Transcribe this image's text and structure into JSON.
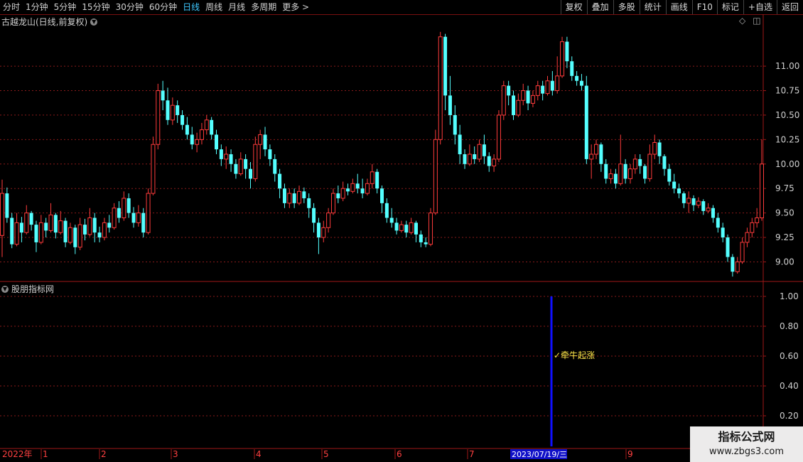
{
  "toolbar": {
    "periods": [
      "分时",
      "1分钟",
      "5分钟",
      "15分钟",
      "30分钟",
      "60分钟",
      "日线",
      "周线",
      "月线",
      "多周期",
      "更多 >"
    ],
    "active_index": 6,
    "right_buttons": [
      "复权",
      "叠加",
      "多股",
      "统计",
      "画线",
      "F10",
      "标记",
      "+自选",
      "返回"
    ]
  },
  "main_panel": {
    "title": "古越龙山(日线,前复权)",
    "price_labels": [
      "11.00",
      "10.75",
      "10.50",
      "10.25",
      "10.00",
      "9.75",
      "9.50",
      "9.25",
      "9.00"
    ]
  },
  "indicator_panel": {
    "title": "股朋指标网",
    "signal_label": "牵牛起涨",
    "axis_labels": [
      "1.00",
      "0.80",
      "0.60",
      "0.40",
      "0.20"
    ]
  },
  "time_axis": {
    "year_label": "2022年",
    "months": [
      "1",
      "2",
      "3",
      "4",
      "5",
      "6",
      "7",
      "9"
    ],
    "cursor_date": "2023/07/19/三"
  },
  "watermark": {
    "title": "指标公式网",
    "url": "www.zbgs3.com"
  },
  "colors": {
    "up": "#ff3b3b",
    "down": "#54ffff",
    "grid": "#8a1a1a",
    "signal": "#1010ff",
    "label": "#ffe84a"
  },
  "chart_data": {
    "type": "candlestick",
    "ylim": [
      8.8,
      11.4
    ],
    "indicator_ylim": [
      0,
      1.05
    ],
    "indicator_signal_value": 1.0,
    "candles": [
      [
        9.27,
        9.7,
        9.05,
        9.84
      ],
      [
        9.7,
        9.45,
        9.4,
        9.76
      ],
      [
        9.45,
        9.18,
        9.14,
        9.5
      ],
      [
        9.18,
        9.4,
        9.16,
        9.5
      ],
      [
        9.4,
        9.3,
        9.2,
        9.46
      ],
      [
        9.3,
        9.5,
        9.28,
        9.58
      ],
      [
        9.5,
        9.38,
        9.32,
        9.52
      ],
      [
        9.38,
        9.2,
        9.1,
        9.42
      ],
      [
        9.2,
        9.4,
        9.18,
        9.48
      ],
      [
        9.4,
        9.32,
        9.25,
        9.45
      ],
      [
        9.32,
        9.48,
        9.3,
        9.6
      ],
      [
        9.48,
        9.3,
        9.24,
        9.5
      ],
      [
        9.3,
        9.42,
        9.28,
        9.52
      ],
      [
        9.42,
        9.2,
        9.15,
        9.45
      ],
      [
        9.2,
        9.35,
        9.18,
        9.4
      ],
      [
        9.35,
        9.15,
        9.08,
        9.38
      ],
      [
        9.15,
        9.38,
        9.12,
        9.45
      ],
      [
        9.38,
        9.28,
        9.22,
        9.44
      ],
      [
        9.28,
        9.45,
        9.26,
        9.55
      ],
      [
        9.45,
        9.3,
        9.2,
        9.5
      ],
      [
        9.3,
        9.25,
        9.2,
        9.36
      ],
      [
        9.25,
        9.4,
        9.22,
        9.45
      ],
      [
        9.4,
        9.35,
        9.3,
        9.48
      ],
      [
        9.35,
        9.55,
        9.33,
        9.6
      ],
      [
        9.55,
        9.45,
        9.4,
        9.62
      ],
      [
        9.45,
        9.65,
        9.42,
        9.72
      ],
      [
        9.65,
        9.5,
        9.45,
        9.7
      ],
      [
        9.5,
        9.4,
        9.35,
        9.56
      ],
      [
        9.4,
        9.5,
        9.36,
        9.58
      ],
      [
        9.5,
        9.3,
        9.25,
        9.55
      ],
      [
        9.3,
        9.7,
        9.28,
        9.75
      ],
      [
        9.7,
        10.2,
        9.68,
        10.28
      ],
      [
        10.2,
        10.75,
        10.15,
        10.82
      ],
      [
        10.75,
        10.65,
        10.55,
        10.85
      ],
      [
        10.65,
        10.45,
        10.4,
        10.78
      ],
      [
        10.45,
        10.6,
        10.4,
        10.68
      ],
      [
        10.6,
        10.5,
        10.42,
        10.65
      ],
      [
        10.5,
        10.4,
        10.35,
        10.55
      ],
      [
        10.4,
        10.3,
        10.25,
        10.48
      ],
      [
        10.3,
        10.2,
        10.15,
        10.38
      ],
      [
        10.2,
        10.25,
        10.12,
        10.32
      ],
      [
        10.25,
        10.35,
        10.2,
        10.42
      ],
      [
        10.35,
        10.45,
        10.3,
        10.5
      ],
      [
        10.45,
        10.3,
        10.25,
        10.48
      ],
      [
        10.3,
        10.15,
        10.1,
        10.35
      ],
      [
        10.15,
        10.05,
        9.98,
        10.2
      ],
      [
        10.05,
        10.1,
        9.95,
        10.18
      ],
      [
        10.1,
        10.0,
        9.92,
        10.15
      ],
      [
        10.0,
        9.9,
        9.85,
        10.05
      ],
      [
        9.9,
        10.05,
        9.88,
        10.12
      ],
      [
        10.05,
        9.95,
        9.85,
        10.1
      ],
      [
        9.95,
        9.85,
        9.75,
        10.02
      ],
      [
        9.85,
        10.2,
        9.82,
        10.28
      ],
      [
        10.2,
        10.3,
        10.05,
        10.35
      ],
      [
        10.3,
        10.15,
        10.08,
        10.38
      ],
      [
        10.15,
        10.05,
        9.98,
        10.2
      ],
      [
        10.05,
        9.9,
        9.82,
        10.1
      ],
      [
        9.9,
        9.75,
        9.65,
        9.95
      ],
      [
        9.75,
        9.6,
        9.55,
        9.8
      ],
      [
        9.6,
        9.7,
        9.55,
        9.75
      ],
      [
        9.7,
        9.6,
        9.55,
        9.75
      ],
      [
        9.6,
        9.72,
        9.58,
        9.78
      ],
      [
        9.72,
        9.65,
        9.6,
        9.76
      ],
      [
        9.65,
        9.55,
        9.45,
        9.7
      ],
      [
        9.55,
        9.4,
        9.3,
        9.6
      ],
      [
        9.4,
        9.25,
        9.08,
        9.45
      ],
      [
        9.25,
        9.35,
        9.2,
        9.42
      ],
      [
        9.35,
        9.5,
        9.3,
        9.55
      ],
      [
        9.5,
        9.7,
        9.48,
        9.75
      ],
      [
        9.7,
        9.65,
        9.6,
        9.78
      ],
      [
        9.65,
        9.75,
        9.62,
        9.82
      ],
      [
        9.75,
        9.72,
        9.68,
        9.8
      ],
      [
        9.72,
        9.8,
        9.7,
        9.85
      ],
      [
        9.8,
        9.75,
        9.7,
        9.9
      ],
      [
        9.75,
        9.7,
        9.65,
        9.85
      ],
      [
        9.7,
        9.8,
        9.68,
        9.85
      ],
      [
        9.8,
        9.92,
        9.75,
        10.0
      ],
      [
        9.92,
        9.75,
        9.7,
        9.95
      ],
      [
        9.75,
        9.6,
        9.5,
        9.78
      ],
      [
        9.6,
        9.45,
        9.4,
        9.65
      ],
      [
        9.45,
        9.4,
        9.35,
        9.55
      ],
      [
        9.4,
        9.32,
        9.28,
        9.45
      ],
      [
        9.32,
        9.38,
        9.3,
        9.42
      ],
      [
        9.38,
        9.3,
        9.25,
        9.42
      ],
      [
        9.3,
        9.4,
        9.28,
        9.45
      ],
      [
        9.4,
        9.28,
        9.2,
        9.42
      ],
      [
        9.28,
        9.2,
        9.15,
        9.32
      ],
      [
        9.2,
        9.18,
        9.15,
        9.25
      ],
      [
        9.18,
        9.5,
        9.16,
        9.55
      ],
      [
        9.5,
        10.25,
        9.48,
        10.35
      ],
      [
        10.25,
        11.3,
        10.2,
        11.35
      ],
      [
        11.3,
        10.7,
        10.55,
        11.33
      ],
      [
        10.7,
        10.5,
        10.4,
        10.9
      ],
      [
        10.5,
        10.3,
        10.2,
        10.6
      ],
      [
        10.3,
        10.1,
        10.0,
        10.4
      ],
      [
        10.1,
        10.0,
        9.95,
        10.15
      ],
      [
        10.0,
        10.1,
        9.98,
        10.2
      ],
      [
        10.1,
        10.05,
        10.0,
        10.18
      ],
      [
        10.05,
        10.2,
        10.02,
        10.25
      ],
      [
        10.2,
        10.08,
        10.0,
        10.3
      ],
      [
        10.08,
        9.98,
        9.92,
        10.12
      ],
      [
        9.98,
        10.05,
        9.92,
        10.1
      ],
      [
        10.05,
        10.5,
        10.02,
        10.55
      ],
      [
        10.5,
        10.8,
        10.45,
        10.85
      ],
      [
        10.8,
        10.7,
        10.6,
        10.85
      ],
      [
        10.7,
        10.5,
        10.45,
        10.75
      ],
      [
        10.5,
        10.65,
        10.48,
        10.72
      ],
      [
        10.65,
        10.75,
        10.6,
        10.82
      ],
      [
        10.75,
        10.62,
        10.55,
        10.8
      ],
      [
        10.62,
        10.7,
        10.58,
        10.75
      ],
      [
        10.7,
        10.8,
        10.65,
        10.85
      ],
      [
        10.8,
        10.72,
        10.65,
        10.85
      ],
      [
        10.72,
        10.85,
        10.7,
        10.9
      ],
      [
        10.85,
        10.75,
        10.7,
        10.95
      ],
      [
        10.75,
        10.9,
        10.72,
        11.1
      ],
      [
        10.9,
        11.25,
        10.88,
        11.3
      ],
      [
        11.25,
        11.05,
        10.98,
        11.3
      ],
      [
        11.05,
        10.9,
        10.85,
        11.1
      ],
      [
        10.9,
        10.85,
        10.8,
        10.95
      ],
      [
        10.85,
        10.8,
        10.75,
        10.92
      ],
      [
        10.8,
        10.05,
        10.0,
        10.9
      ],
      [
        10.05,
        10.1,
        9.85,
        10.2
      ],
      [
        10.1,
        10.2,
        10.05,
        10.25
      ],
      [
        10.2,
        10.0,
        9.92,
        10.22
      ],
      [
        10.0,
        9.85,
        9.8,
        10.05
      ],
      [
        9.85,
        9.9,
        9.8,
        9.95
      ],
      [
        9.9,
        9.8,
        9.75,
        9.95
      ],
      [
        9.8,
        10.0,
        9.78,
        10.3
      ],
      [
        10.0,
        9.85,
        9.8,
        10.05
      ],
      [
        9.85,
        9.95,
        9.8,
        10.0
      ],
      [
        9.95,
        10.05,
        9.9,
        10.1
      ],
      [
        10.05,
        9.98,
        9.9,
        10.1
      ],
      [
        9.98,
        9.85,
        9.8,
        10.0
      ],
      [
        9.85,
        10.1,
        9.82,
        10.2
      ],
      [
        10.1,
        10.22,
        10.05,
        10.3
      ],
      [
        10.22,
        10.08,
        10.0,
        10.25
      ],
      [
        10.08,
        9.95,
        9.88,
        10.1
      ],
      [
        9.95,
        9.82,
        9.78,
        10.0
      ],
      [
        9.82,
        9.75,
        9.7,
        9.9
      ],
      [
        9.75,
        9.7,
        9.65,
        9.8
      ],
      [
        9.7,
        9.6,
        9.55,
        9.72
      ],
      [
        9.6,
        9.65,
        9.5,
        9.72
      ],
      [
        9.65,
        9.58,
        9.52,
        9.68
      ],
      [
        9.58,
        9.62,
        9.55,
        9.66
      ],
      [
        9.62,
        9.52,
        9.48,
        9.64
      ],
      [
        9.52,
        9.55,
        9.5,
        9.6
      ],
      [
        9.55,
        9.45,
        9.4,
        9.58
      ],
      [
        9.45,
        9.35,
        9.3,
        9.5
      ],
      [
        9.35,
        9.25,
        9.2,
        9.4
      ],
      [
        9.25,
        9.05,
        9.0,
        9.28
      ],
      [
        9.05,
        8.9,
        8.85,
        9.08
      ],
      [
        8.9,
        9.0,
        8.88,
        9.05
      ],
      [
        9.0,
        9.2,
        8.98,
        9.25
      ],
      [
        9.2,
        9.3,
        9.15,
        9.35
      ],
      [
        9.3,
        9.4,
        9.25,
        9.45
      ],
      [
        9.4,
        9.45,
        9.35,
        9.55
      ],
      [
        9.45,
        10.0,
        9.42,
        10.25
      ]
    ]
  }
}
